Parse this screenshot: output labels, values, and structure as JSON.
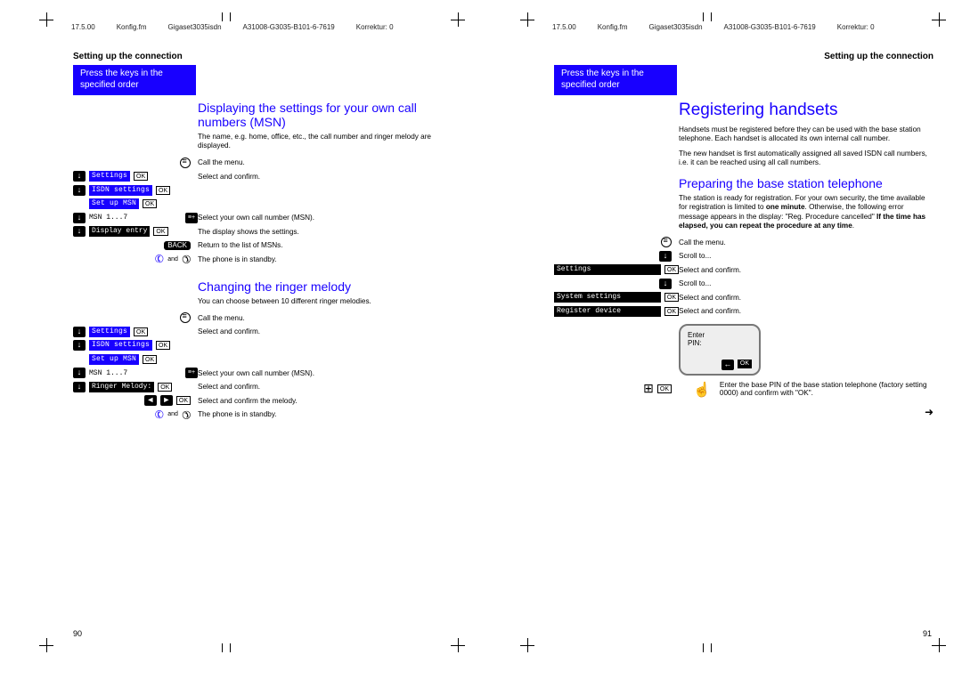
{
  "print_header": {
    "date": "17.5.00",
    "file": "Konfig.fm",
    "product": "Gigaset3035isdn",
    "code": "A31008-G3035-B101-6-7619",
    "korrektur": "Korrektur: 0"
  },
  "common": {
    "section_title": "Setting up the connection",
    "blue_tab": "Press the keys in the specified order",
    "ok": "OK",
    "back": "BACK",
    "and": "and",
    "msn_range": "MSN 1...7"
  },
  "labels": {
    "settings": "Settings",
    "isdn_settings": "ISDN settings",
    "set_up_msn": "Set up MSN",
    "display_entry": "Display entry",
    "ringer_melody": "Ringer Melody:",
    "system_settings": "System settings",
    "register_device": "Register device"
  },
  "left_page": {
    "h2a": "Displaying the settings for your own call numbers (MSN)",
    "body1": "The name, e.g. home, office, etc., the call number and ringer melody are displayed.",
    "steps_a": {
      "call_menu": "Call the menu.",
      "select_confirm": "Select and confirm.",
      "select_msn": "Select your own call number (MSN).",
      "display_shows": "The display shows the settings.",
      "return_list": "Return to the list of MSNs.",
      "standby": "The phone is in standby."
    },
    "h2b": "Changing the ringer melody",
    "body2": "You can choose between 10 different ringer melodies.",
    "steps_b": {
      "call_menu": "Call the menu.",
      "select_confirm": "Select and confirm.",
      "select_msn": "Select your own call number (MSN).",
      "select_confirm_melody": "Select and confirm the melody.",
      "standby": "The phone is in standby."
    },
    "page_number": "90"
  },
  "right_page": {
    "h1": "Registering handsets",
    "body1": "Handsets must be registered before they can be used with the base station telephone. Each handset is allocated its own internal call number.",
    "body2": "The new handset is first automatically assigned all saved ISDN call numbers, i.e. it can be reached using all call numbers.",
    "h2": "Preparing the base station telephone",
    "body3_a": "The station is ready for registration. For your own security, the time available for registration is limited to ",
    "body3_bold1": "one minute",
    "body3_b": ". Otherwise, the following error message appears in the display: \"Reg. Procedure cancelled\" ",
    "body3_bold2": "If the time has elapsed, you can repeat the procedure at any time",
    "body3_c": ".",
    "steps": {
      "call_menu": "Call the menu.",
      "scroll_to": "Scroll to...",
      "select_confirm": "Select and confirm."
    },
    "mini_screen": {
      "line1": "Enter",
      "line2": "PIN:"
    },
    "touch_text": "Enter the base PIN of the base station telephone (factory setting 0000) and confirm with \"OK\".",
    "continue_arrow": "➜",
    "page_number": "91"
  }
}
